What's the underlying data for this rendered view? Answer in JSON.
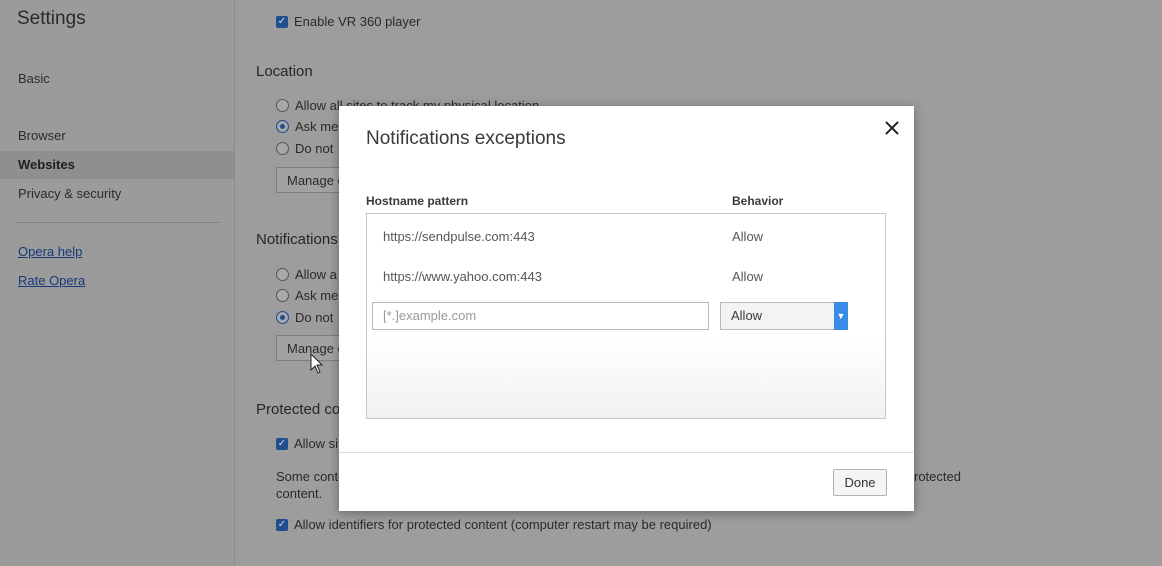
{
  "sidebar": {
    "title": "Settings",
    "items": [
      {
        "label": "Basic"
      },
      {
        "label": "Browser"
      },
      {
        "label": "Websites"
      },
      {
        "label": "Privacy & security"
      }
    ],
    "links": [
      {
        "label": "Opera help"
      },
      {
        "label": "Rate Opera"
      }
    ]
  },
  "main": {
    "vr_checkbox": "Enable VR 360 player",
    "location": {
      "title": "Location",
      "options": [
        "Allow all sites to track my physical location",
        "Ask me",
        "Do not"
      ],
      "manage_button": "Manage e"
    },
    "notifications": {
      "title": "Notifications",
      "options": [
        "Allow a",
        "Ask me",
        "Do not"
      ],
      "manage_button": "Manage e"
    },
    "protected": {
      "title": "Protected co",
      "allow_checkbox": "Allow si",
      "description_left": "Some conte",
      "description_right": "rotected",
      "description_line2": "content.",
      "identifiers_checkbox": "Allow identifiers for protected content (computer restart may be required)"
    }
  },
  "dialog": {
    "title": "Notifications exceptions",
    "columns": {
      "hostname": "Hostname pattern",
      "behavior": "Behavior"
    },
    "rows": [
      {
        "host": "https://sendpulse.com:443",
        "behavior": "Allow"
      },
      {
        "host": "https://www.yahoo.com:443",
        "behavior": "Allow"
      }
    ],
    "new_entry": {
      "placeholder": "[*.]example.com",
      "behavior": "Allow"
    },
    "done_label": "Done"
  },
  "colors": {
    "accent": "#3a8be8",
    "checkbox": "#1f4f8f"
  }
}
